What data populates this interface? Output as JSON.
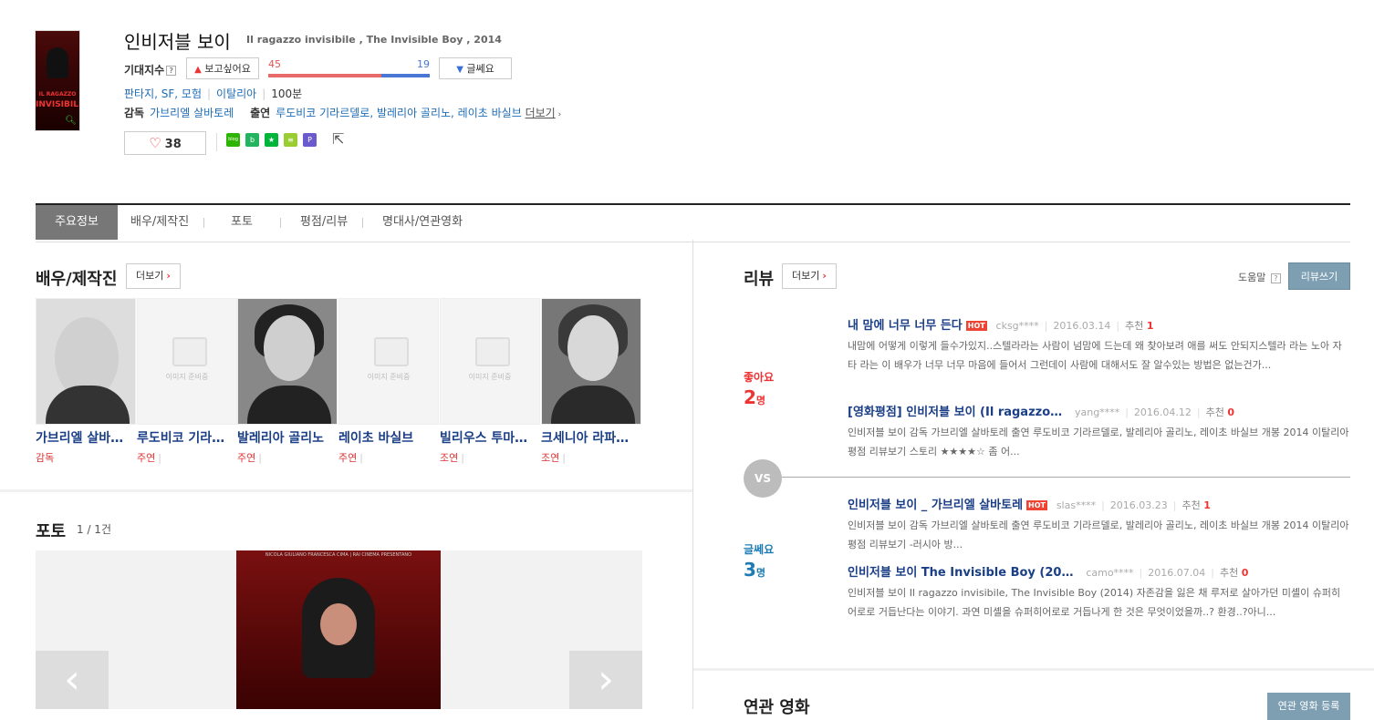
{
  "movie": {
    "title_ko": "인비저블 보이",
    "title_orig": "Il ragazzo invisibile , The Invisible Boy , 2014",
    "poster_text_top": "IL RAGAZZO",
    "poster_text_main": "INVISIBILE",
    "expect_label": "기대지수",
    "help_mark": "?",
    "want_label": "보고싶어요",
    "meh_label": "글쎄요",
    "want_count": "45",
    "meh_count": "19",
    "want_ratio": 0.703,
    "genres": "판타지, SF, 모험",
    "country": "이탈리아",
    "runtime": "100분",
    "director_label": "감독",
    "director": "가브리엘 살바토레",
    "cast_label": "출연",
    "cast": "루도비코 기라르델로, 발레리아 골리노, 레이초 바실브",
    "more_link": "더보기",
    "like_count": "38",
    "sns": [
      {
        "icon": "blog-icon",
        "text": "blog",
        "color": "#2db400"
      },
      {
        "icon": "band-icon",
        "text": "b",
        "color": "#24b35e"
      },
      {
        "icon": "star-icon",
        "text": "★",
        "color": "#00b43c"
      },
      {
        "icon": "memo-icon",
        "text": "≡",
        "color": "#9acd32"
      },
      {
        "icon": "pin-icon",
        "text": "P",
        "color": "#6a5acd"
      }
    ]
  },
  "tabs": [
    "주요정보",
    "배우/제작진",
    "포토",
    "평점/리뷰",
    "명대사/연관영화"
  ],
  "cast_section": {
    "title": "배우/제작진",
    "more": "더보기",
    "no_image": "이미지 준비중",
    "people": [
      {
        "name": "가브리엘 살바토레",
        "role": "감독"
      },
      {
        "name": "루도비코 기라르델로",
        "role": "주연"
      },
      {
        "name": "발레리아 골리노",
        "role": "주연"
      },
      {
        "name": "레이초 바실브",
        "role": "주연"
      },
      {
        "name": "빌리우스 투마리스",
        "role": "조연"
      },
      {
        "name": "크세니아 라파포트",
        "role": "조연"
      }
    ]
  },
  "photo_section": {
    "title": "포토",
    "count": "1 / 1건",
    "photo_header": "NICOLA GIULIANO FRANCESCA CIMA | RAI CINEMA PRESENTANO"
  },
  "review_section": {
    "title": "리뷰",
    "more": "더보기",
    "help": "도움말",
    "write": "리뷰쓰기",
    "good_label": "좋아요",
    "good_count": "2",
    "meh_label": "글쎄요",
    "meh_count": "3",
    "unit": "명",
    "vs": "VS",
    "hot": "HOT",
    "rec_label": "추천",
    "reviews": [
      {
        "title": "내 맘에 너무 너무 든다",
        "hot": true,
        "user": "cksg****",
        "date": "2016.03.14",
        "rec": "1",
        "body": "내맘에 어떻게 이렇게 들수가있지..스텔라라는 사람이 넘맘에 드는데 왜 찾아보려 애를 써도 안되지스텔라 라는 노아 자타 라는 이 배우가 너무 너무 마음에 들어서 그런데이 사람에 대해서도 잘 알수있는 방법은 없는건가..."
      },
      {
        "title": "[영화평점] 인비저블 보이 (Il ragazzo…",
        "hot": false,
        "user": "yang****",
        "date": "2016.04.12",
        "rec": "0",
        "body": "인비저블 보이 감독 가브리엘 살바토레 출연 루도비코 기라르델로, 발레리아 골리노, 레이초 바실브 개봉 2014 이탈리아 평점 리뷰보기 스토리 ★★★★☆ 좀 어..."
      },
      {
        "title": "인비저블 보이 _ 가브리엘 살바토레",
        "hot": true,
        "user": "slas****",
        "date": "2016.03.23",
        "rec": "1",
        "body": "인비저블 보이 감독 가브리엘 살바토레 출연 루도비코 기라르델로, 발레리아 골리노, 레이초 바실브 개봉 2014 이탈리아 평점 리뷰보기 -러시아 방..."
      },
      {
        "title": "인비저블 보이 The Invisible Boy (20…",
        "hot": false,
        "user": "camo****",
        "date": "2016.07.04",
        "rec": "0",
        "body": "인비저블 보이 Il ragazzo invisibile, The Invisible Boy (2014) 자존감을 잃은 채 루저로 살아가던 미셸이 슈퍼히어로로 거듭난다는 이야기. 과연 미셸을 슈퍼히어로로 거듭나게 한 것은 무엇이었을까..? 환경..?아니..."
      }
    ]
  },
  "related": {
    "title": "연관 영화",
    "add": "연관 영화 등록"
  },
  "colors": {
    "accent_red": "#e33333",
    "link_blue": "#1a3f86",
    "meh_blue": "#1e7cb5",
    "tab_active": "#777777",
    "write_btn": "#7e9fb2"
  }
}
